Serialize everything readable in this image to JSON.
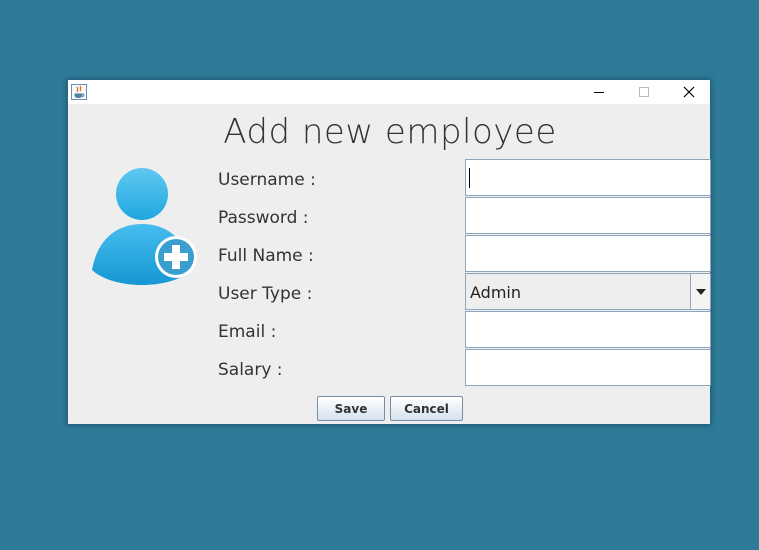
{
  "window": {
    "title": "Add new employee"
  },
  "form": {
    "labels": {
      "username": "Username :",
      "password": "Password :",
      "full_name": "Full Name :",
      "user_type": "User Type :",
      "email": "Email :",
      "salary": "Salary :"
    },
    "values": {
      "username": "",
      "password": "",
      "full_name": "",
      "email": "",
      "salary": ""
    },
    "user_type_selected": "Admin"
  },
  "buttons": {
    "save": "Save",
    "cancel": "Cancel"
  },
  "icons": {
    "app": "java-icon",
    "avatar": "add-user-icon",
    "minimize": "minimize-icon",
    "maximize": "maximize-icon",
    "close": "close-icon",
    "dropdown": "chevron-down-icon"
  },
  "colors": {
    "desktop": "#2e7b99",
    "window_bg": "#eeeeee",
    "avatar_blue": "#1aa3d9"
  }
}
